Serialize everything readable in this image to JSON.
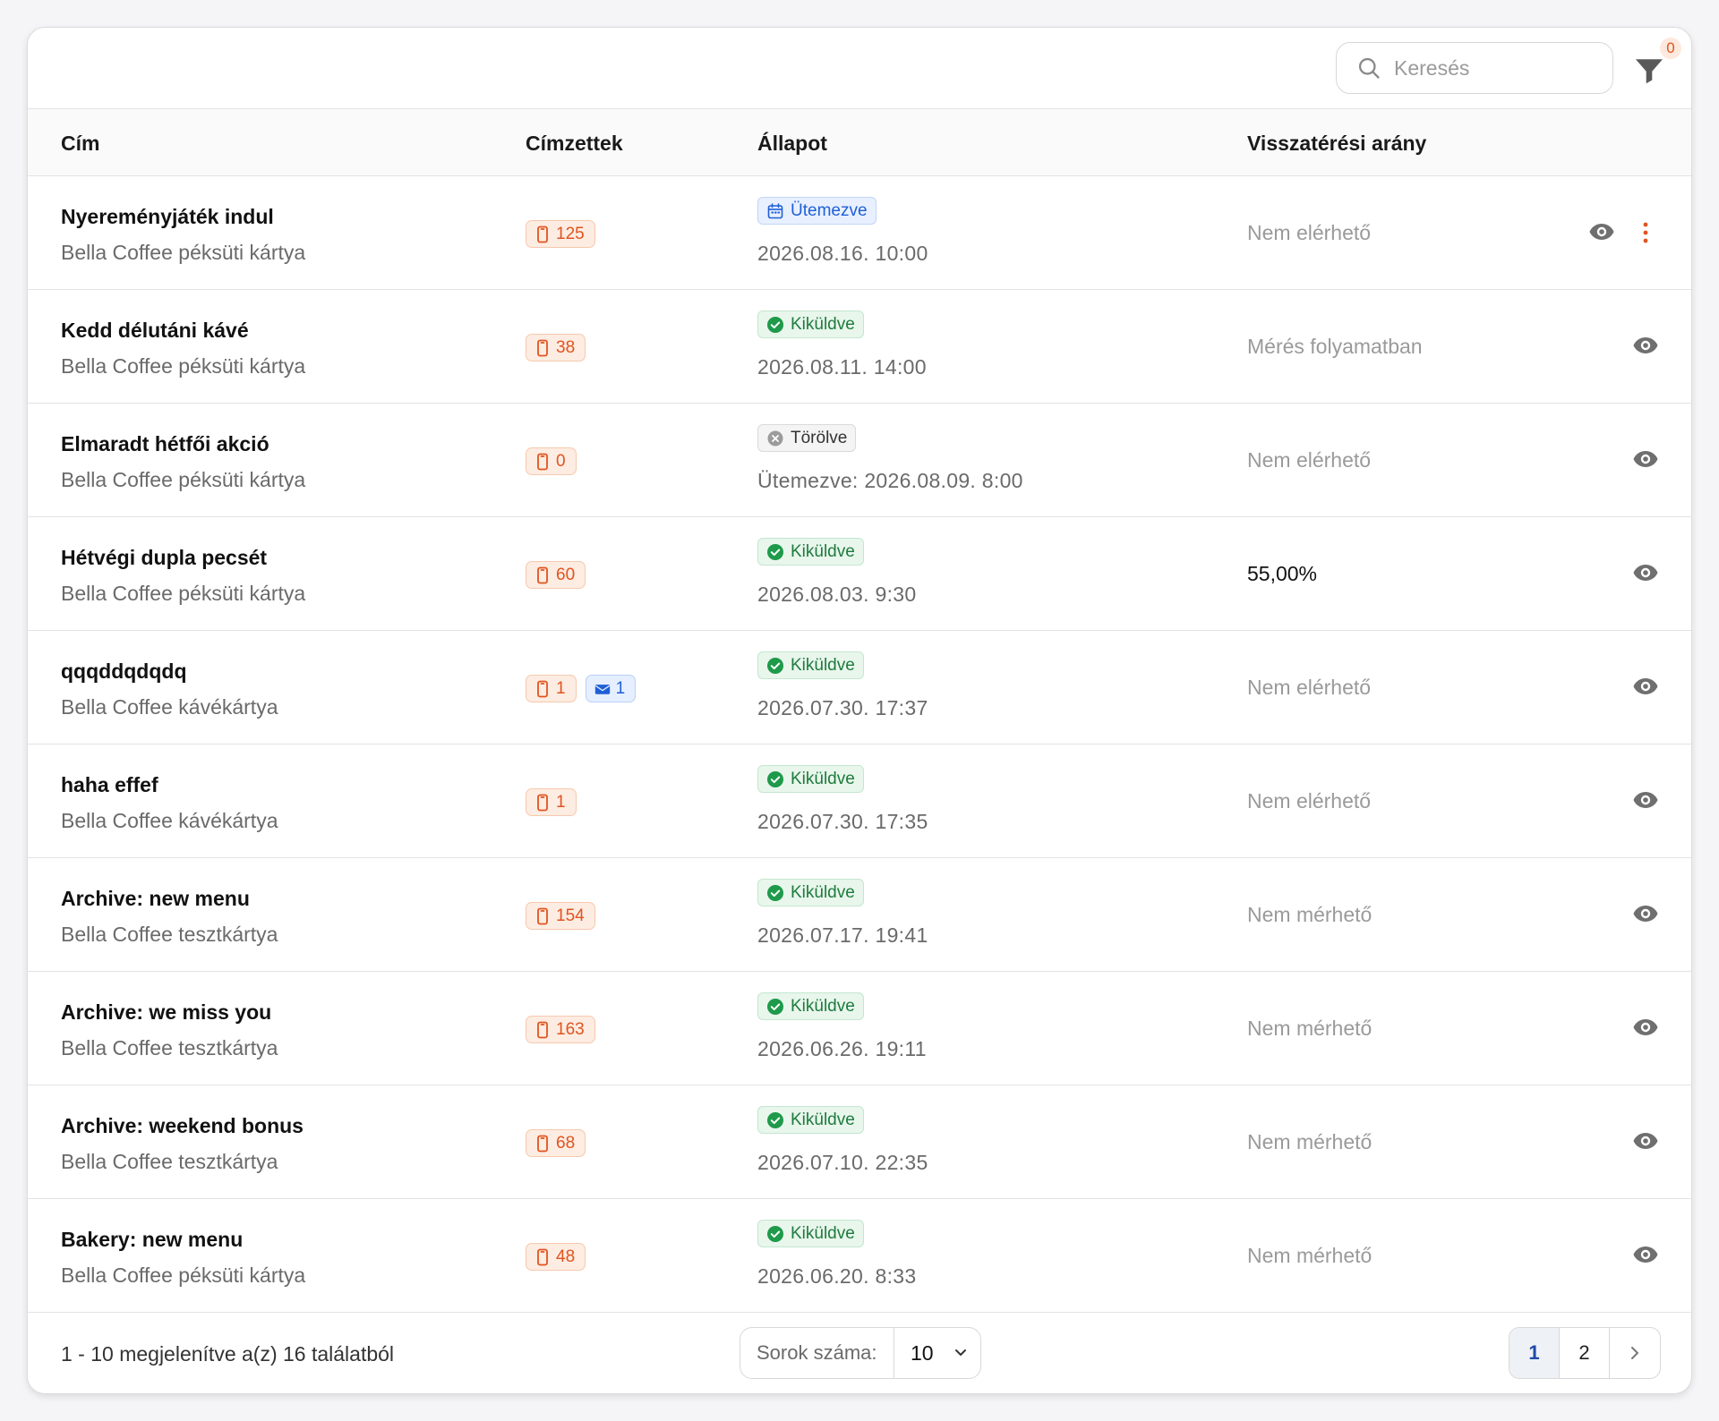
{
  "search": {
    "placeholder": "Keresés"
  },
  "filter": {
    "count": "0"
  },
  "columns": {
    "title": "Cím",
    "recipients": "Címzettek",
    "status": "Állapot",
    "return_rate": "Visszatérési arány"
  },
  "rows": [
    {
      "title": "Nyereményjáték indul",
      "card": "Bella Coffee péksüti kártya",
      "sms": "125",
      "email": "",
      "status": "Ütemezve",
      "status_type": "sched",
      "date": "2026.08.16. 10:00",
      "rate": "Nem elérhető",
      "rate_is_value": false
    },
    {
      "title": "Kedd délutáni kávé",
      "card": "Bella Coffee péksüti kártya",
      "sms": "38",
      "email": "",
      "status": "Kiküldve",
      "status_type": "sent",
      "date": "2026.08.11. 14:00",
      "rate": "Mérés folyamatban",
      "rate_is_value": false
    },
    {
      "title": "Elmaradt hétfői akció",
      "card": "Bella Coffee péksüti kártya",
      "sms": "0",
      "email": "",
      "status": "Törölve",
      "status_type": "del",
      "date": "Ütemezve: 2026.08.09. 8:00",
      "rate": "Nem elérhető",
      "rate_is_value": false
    },
    {
      "title": "Hétvégi dupla pecsét",
      "card": "Bella Coffee péksüti kártya",
      "sms": "60",
      "email": "",
      "status": "Kiküldve",
      "status_type": "sent",
      "date": "2026.08.03. 9:30",
      "rate": "55,00%",
      "rate_is_value": true
    },
    {
      "title": "qqqddqdqdq",
      "card": "Bella Coffee kávékártya",
      "sms": "1",
      "email": "1",
      "status": "Kiküldve",
      "status_type": "sent",
      "date": "2026.07.30. 17:37",
      "rate": "Nem elérhető",
      "rate_is_value": false
    },
    {
      "title": "haha effef",
      "card": "Bella Coffee kávékártya",
      "sms": "1",
      "email": "",
      "status": "Kiküldve",
      "status_type": "sent",
      "date": "2026.07.30. 17:35",
      "rate": "Nem elérhető",
      "rate_is_value": false
    },
    {
      "title": "Archive: new menu",
      "card": "Bella Coffee tesztkártya",
      "sms": "154",
      "email": "",
      "status": "Kiküldve",
      "status_type": "sent",
      "date": "2026.07.17. 19:41",
      "rate": "Nem mérhető",
      "rate_is_value": false
    },
    {
      "title": "Archive: we miss you",
      "card": "Bella Coffee tesztkártya",
      "sms": "163",
      "email": "",
      "status": "Kiküldve",
      "status_type": "sent",
      "date": "2026.06.26. 19:11",
      "rate": "Nem mérhető",
      "rate_is_value": false
    },
    {
      "title": "Archive: weekend bonus",
      "card": "Bella Coffee tesztkártya",
      "sms": "68",
      "email": "",
      "status": "Kiküldve",
      "status_type": "sent",
      "date": "2026.07.10. 22:35",
      "rate": "Nem mérhető",
      "rate_is_value": false
    },
    {
      "title": "Bakery: new menu",
      "card": "Bella Coffee péksüti kártya",
      "sms": "48",
      "email": "",
      "status": "Kiküldve",
      "status_type": "sent",
      "date": "2026.06.20. 8:33",
      "rate": "Nem mérhető",
      "rate_is_value": false
    }
  ],
  "footer": {
    "page_info": "1 - 10 megjelenítve a(z) 16 találatból",
    "rows_label": "Sorok száma:",
    "rows_value": "10",
    "pages": [
      "1",
      "2"
    ],
    "current_page": "1"
  },
  "colors": {
    "accent_orange": "#e0541f",
    "sent_green": "#1e7b3d",
    "scheduled_blue": "#1f5fd6"
  }
}
